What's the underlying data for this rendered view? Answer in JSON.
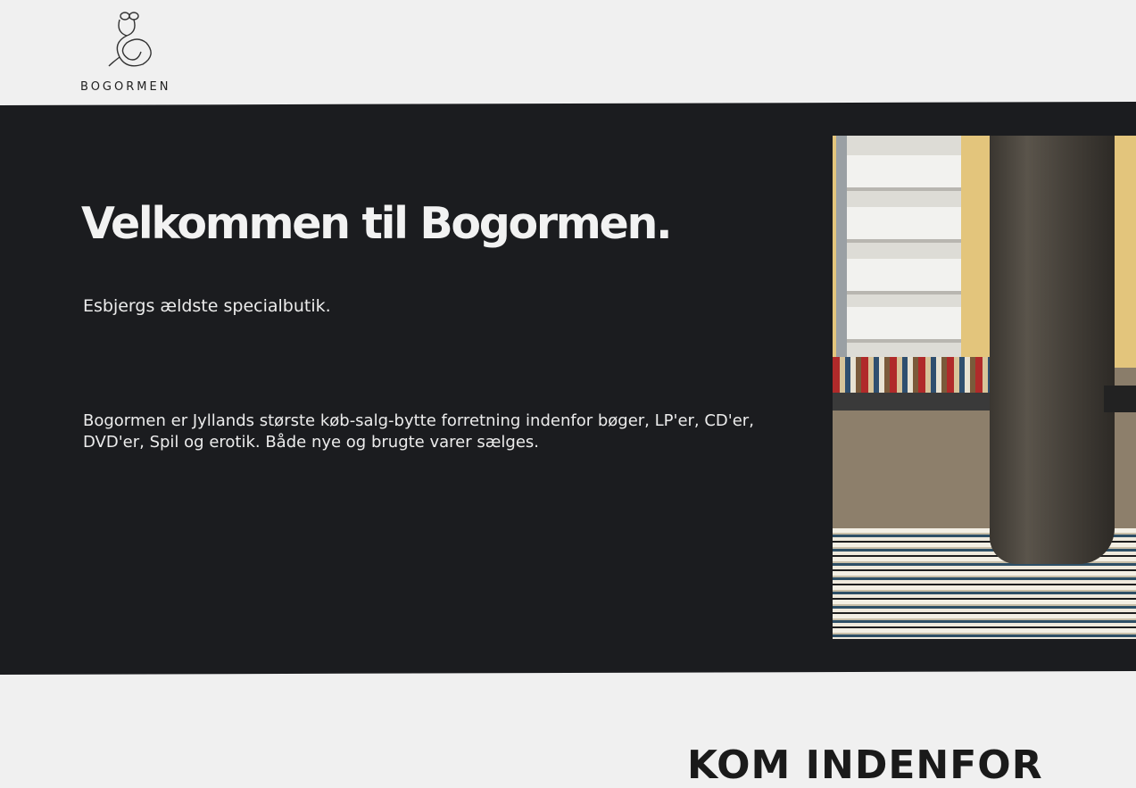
{
  "header": {
    "logo_text": "BOGORMEN",
    "logo_icon": "bookworm-logo-icon"
  },
  "hero": {
    "title": "Velkommen til Bogormen.",
    "subtitle": "Esbjergs ældste specialbutik.",
    "description": "Bogormen er Jyllands største køb-salg-bytte forretning indenfor bøger, LP'er, CD'er, DVD'er, Spil og erotik. Både nye og brugte varer sælges.",
    "image": "bookstall-street-photo"
  },
  "section": {
    "heading": "KOM INDENFOR"
  },
  "colors": {
    "page_bg": "#f0f0f0",
    "hero_bg": "#1b1c1f",
    "hero_text": "#f2f2f2"
  }
}
